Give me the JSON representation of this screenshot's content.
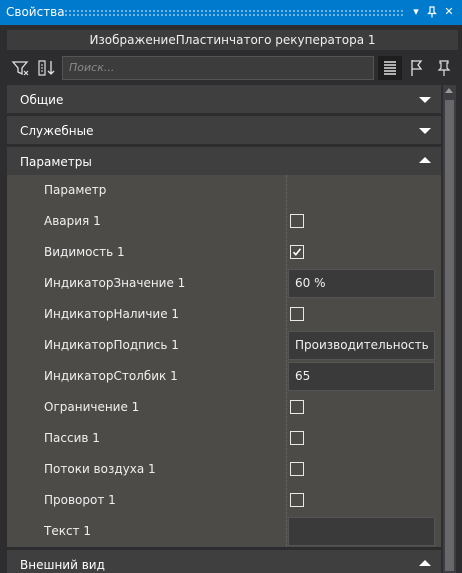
{
  "panel": {
    "title": "Свойства",
    "buttons": [
      {
        "name": "dropdown",
        "glyph": "▾"
      },
      {
        "name": "pin",
        "glyph": "⊢"
      },
      {
        "name": "close",
        "glyph": "✕"
      }
    ]
  },
  "object_name": "ИзображениеПластинчатого рекуператора 1",
  "toolbar": {
    "search_placeholder": "Поиск...",
    "icons": [
      "filter-icon",
      "sort-icon",
      "list-view-icon",
      "flag-icon",
      "pin-icon"
    ]
  },
  "categories": {
    "general": {
      "label": "Общие",
      "expanded": false
    },
    "service": {
      "label": "Служебные",
      "expanded": false
    },
    "params": {
      "label": "Параметры",
      "expanded": true
    },
    "appearance": {
      "label": "Внешний вид",
      "expanded": true
    }
  },
  "params_header": "Параметр",
  "properties": [
    {
      "label": "Авария 1",
      "type": "checkbox",
      "checked": false
    },
    {
      "label": "Видимость 1",
      "type": "checkbox",
      "checked": true
    },
    {
      "label": "ИндикаторЗначение 1",
      "type": "text",
      "value": "60 %"
    },
    {
      "label": "ИндикаторНаличие 1",
      "type": "checkbox",
      "checked": false
    },
    {
      "label": "ИндикаторПодпись 1",
      "type": "text",
      "value": "Производительность"
    },
    {
      "label": "ИндикаторСтолбик 1",
      "type": "text",
      "value": "65"
    },
    {
      "label": "Ограничение 1",
      "type": "checkbox",
      "checked": false
    },
    {
      "label": "Пассив 1",
      "type": "checkbox",
      "checked": false
    },
    {
      "label": "Потоки воздуха 1",
      "type": "checkbox",
      "checked": false
    },
    {
      "label": "Проворот 1",
      "type": "checkbox",
      "checked": false
    },
    {
      "label": "Текст 1",
      "type": "text",
      "value": ""
    }
  ]
}
